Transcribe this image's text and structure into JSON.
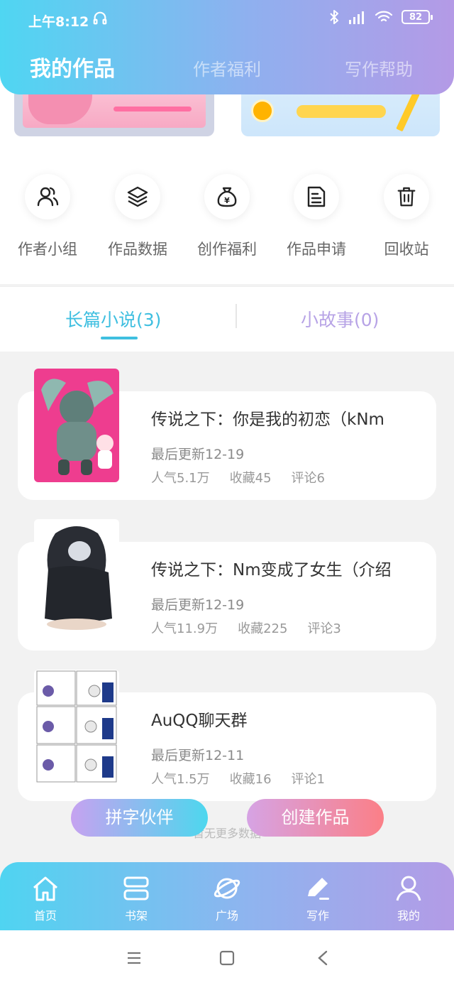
{
  "status_bar": {
    "time": "上午8:12",
    "battery": "82"
  },
  "top_tabs": [
    "我的作品",
    "作者福利",
    "写作帮助"
  ],
  "menu": [
    {
      "label": "作者小组",
      "icon": "group-icon"
    },
    {
      "label": "作品数据",
      "icon": "layers-icon"
    },
    {
      "label": "创作福利",
      "icon": "money-bag-icon"
    },
    {
      "label": "作品申请",
      "icon": "document-icon"
    },
    {
      "label": "回收站",
      "icon": "trash-icon"
    }
  ],
  "work_tabs": {
    "long": "长篇小说(3)",
    "short": "小故事(0)"
  },
  "works": [
    {
      "title": "传说之下：你是我的初恋（kNm",
      "updated": "最后更新12-19",
      "popularity": "人气5.1万",
      "favorites": "收藏45",
      "comments": "评论6"
    },
    {
      "title": "传说之下：Nm变成了女生（介绍",
      "updated": "最后更新12-19",
      "popularity": "人气11.9万",
      "favorites": "收藏225",
      "comments": "评论3"
    },
    {
      "title": "AuQQ聊天群",
      "updated": "最后更新12-11",
      "popularity": "人气1.5万",
      "favorites": "收藏16",
      "comments": "评论1"
    }
  ],
  "no_more": "暂无更多数据",
  "buttons": {
    "partner": "拼字伙伴",
    "create": "创建作品"
  },
  "bottom_nav": [
    {
      "label": "首页",
      "icon": "home-icon"
    },
    {
      "label": "书架",
      "icon": "bookshelf-icon"
    },
    {
      "label": "广场",
      "icon": "planet-icon"
    },
    {
      "label": "写作",
      "icon": "pen-icon"
    },
    {
      "label": "我的",
      "icon": "user-icon"
    }
  ],
  "colors": {
    "accent_cyan": "#3fbfe0",
    "accent_purple": "#b7a3e6",
    "create_pink": "#fb7f87"
  }
}
